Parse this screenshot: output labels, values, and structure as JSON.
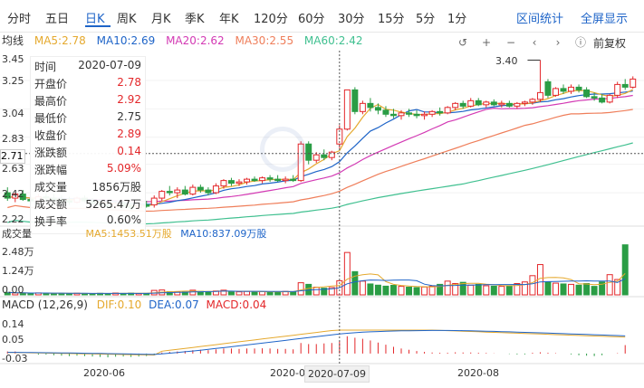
{
  "tabs": [
    "分时",
    "五日",
    "日K",
    "周K",
    "月K",
    "季K",
    "年K",
    "120分",
    "60分",
    "30分",
    "15分",
    "5分",
    "1分"
  ],
  "active_tab": "日K",
  "top_buttons": {
    "interval_stats": "区间统计",
    "fullscreen": "全屏显示"
  },
  "ma": {
    "label": "均线",
    "ma5": "MA5:2.78",
    "ma10": "MA10:2.69",
    "ma20": "MA20:2.62",
    "ma30": "MA30:2.55",
    "ma60": "MA60:2.42",
    "colors": {
      "ma5": "#e5a92e",
      "ma10": "#1e64c8",
      "ma20": "#d33ab4",
      "ma30": "#ef7e5a",
      "ma60": "#40c090"
    }
  },
  "toolbar": {
    "restore": "↺",
    "zoom_in": "+",
    "zoom_out": "−",
    "left": "‹",
    "right": "›",
    "info": "ⓘ",
    "adjust": "前复权"
  },
  "price_axis": [
    "3.45",
    "3.25",
    "3.04",
    "2.83",
    "2.63",
    "2.42",
    "2.22"
  ],
  "current_price_label": "2.71",
  "high_tag": "3.40",
  "tooltip": [
    {
      "label": "时间",
      "value": "2020-07-09",
      "red": false
    },
    {
      "label": "开盘价",
      "value": "2.78",
      "red": true
    },
    {
      "label": "最高价",
      "value": "2.92",
      "red": true
    },
    {
      "label": "最低价",
      "value": "2.75",
      "red": false
    },
    {
      "label": "收盘价",
      "value": "2.89",
      "red": true
    },
    {
      "label": "涨跌额",
      "value": "0.14",
      "red": true
    },
    {
      "label": "涨跌幅",
      "value": "5.09%",
      "red": true
    },
    {
      "label": "成交量",
      "value": "1856万股",
      "red": false
    },
    {
      "label": "成交额",
      "value": "5265.47万",
      "red": false
    },
    {
      "label": "换手率",
      "value": "0.60%",
      "red": false
    }
  ],
  "volume": {
    "label": "成交量",
    "ma5": "MA5:1453.51万股",
    "ma10": "MA10:837.09万股",
    "axis": [
      "2.48万",
      "1.24万",
      "0.00"
    ]
  },
  "macd": {
    "label": "MACD (12,26,9)",
    "dif": "DIF:0.10",
    "dea": "DEA:0.07",
    "macd": "MACD:0.04",
    "axis": [
      "0.14",
      "0.05",
      "-0.03"
    ]
  },
  "x_labels": [
    "2020-06",
    "2020-07",
    "2020-08"
  ],
  "crosshair_date": "2020-07-09",
  "candles": [
    {
      "o": 2.42,
      "h": 2.46,
      "l": 2.36,
      "c": 2.38
    },
    {
      "o": 2.38,
      "h": 2.42,
      "l": 2.35,
      "c": 2.41
    },
    {
      "o": 2.41,
      "h": 2.44,
      "l": 2.36,
      "c": 2.37
    },
    {
      "o": 2.37,
      "h": 2.4,
      "l": 2.33,
      "c": 2.36
    },
    {
      "o": 2.36,
      "h": 2.41,
      "l": 2.34,
      "c": 2.39
    },
    {
      "o": 2.39,
      "h": 2.42,
      "l": 2.36,
      "c": 2.38
    },
    {
      "o": 2.38,
      "h": 2.41,
      "l": 2.35,
      "c": 2.37
    },
    {
      "o": 2.37,
      "h": 2.4,
      "l": 2.34,
      "c": 2.36
    },
    {
      "o": 2.36,
      "h": 2.39,
      "l": 2.33,
      "c": 2.35
    },
    {
      "o": 2.35,
      "h": 2.39,
      "l": 2.34,
      "c": 2.38
    },
    {
      "o": 2.38,
      "h": 2.4,
      "l": 2.35,
      "c": 2.36
    },
    {
      "o": 2.36,
      "h": 2.38,
      "l": 2.33,
      "c": 2.34
    },
    {
      "o": 2.34,
      "h": 2.37,
      "l": 2.31,
      "c": 2.33
    },
    {
      "o": 2.33,
      "h": 2.36,
      "l": 2.3,
      "c": 2.32
    },
    {
      "o": 2.32,
      "h": 2.35,
      "l": 2.3,
      "c": 2.34
    },
    {
      "o": 2.34,
      "h": 2.36,
      "l": 2.31,
      "c": 2.32
    },
    {
      "o": 2.32,
      "h": 2.34,
      "l": 2.29,
      "c": 2.31
    },
    {
      "o": 2.31,
      "h": 2.34,
      "l": 2.29,
      "c": 2.33
    },
    {
      "o": 2.33,
      "h": 2.36,
      "l": 2.31,
      "c": 2.32
    },
    {
      "o": 2.33,
      "h": 2.4,
      "l": 2.31,
      "c": 2.38
    },
    {
      "o": 2.38,
      "h": 2.44,
      "l": 2.36,
      "c": 2.43
    },
    {
      "o": 2.43,
      "h": 2.47,
      "l": 2.4,
      "c": 2.42
    },
    {
      "o": 2.42,
      "h": 2.46,
      "l": 2.38,
      "c": 2.44
    },
    {
      "o": 2.44,
      "h": 2.47,
      "l": 2.4,
      "c": 2.41
    },
    {
      "o": 2.41,
      "h": 2.48,
      "l": 2.4,
      "c": 2.46
    },
    {
      "o": 2.46,
      "h": 2.48,
      "l": 2.42,
      "c": 2.44
    },
    {
      "o": 2.44,
      "h": 2.46,
      "l": 2.4,
      "c": 2.42
    },
    {
      "o": 2.42,
      "h": 2.49,
      "l": 2.41,
      "c": 2.47
    },
    {
      "o": 2.47,
      "h": 2.52,
      "l": 2.45,
      "c": 2.51
    },
    {
      "o": 2.51,
      "h": 2.53,
      "l": 2.47,
      "c": 2.49
    },
    {
      "o": 2.49,
      "h": 2.52,
      "l": 2.47,
      "c": 2.5
    },
    {
      "o": 2.5,
      "h": 2.53,
      "l": 2.48,
      "c": 2.52
    },
    {
      "o": 2.52,
      "h": 2.54,
      "l": 2.5,
      "c": 2.51
    },
    {
      "o": 2.51,
      "h": 2.54,
      "l": 2.49,
      "c": 2.53
    },
    {
      "o": 2.53,
      "h": 2.55,
      "l": 2.5,
      "c": 2.52
    },
    {
      "o": 2.52,
      "h": 2.55,
      "l": 2.5,
      "c": 2.51
    },
    {
      "o": 2.51,
      "h": 2.54,
      "l": 2.49,
      "c": 2.52
    },
    {
      "o": 2.52,
      "h": 2.55,
      "l": 2.5,
      "c": 2.51
    },
    {
      "o": 2.51,
      "h": 2.8,
      "l": 2.5,
      "c": 2.78
    },
    {
      "o": 2.78,
      "h": 2.8,
      "l": 2.63,
      "c": 2.66
    },
    {
      "o": 2.66,
      "h": 2.72,
      "l": 2.64,
      "c": 2.7
    },
    {
      "o": 2.7,
      "h": 2.74,
      "l": 2.66,
      "c": 2.68
    },
    {
      "o": 2.68,
      "h": 2.73,
      "l": 2.66,
      "c": 2.72
    },
    {
      "o": 2.78,
      "h": 2.92,
      "l": 2.75,
      "c": 2.89
    },
    {
      "o": 2.89,
      "h": 3.18,
      "l": 2.88,
      "c": 3.18
    },
    {
      "o": 3.18,
      "h": 3.2,
      "l": 3.0,
      "c": 3.02
    },
    {
      "o": 3.02,
      "h": 3.1,
      "l": 3.0,
      "c": 3.08
    },
    {
      "o": 3.08,
      "h": 3.12,
      "l": 3.02,
      "c": 3.05
    },
    {
      "o": 3.05,
      "h": 3.08,
      "l": 3.0,
      "c": 3.03
    },
    {
      "o": 3.03,
      "h": 3.06,
      "l": 2.98,
      "c": 3.0
    },
    {
      "o": 3.0,
      "h": 3.04,
      "l": 2.97,
      "c": 2.99
    },
    {
      "o": 2.99,
      "h": 3.03,
      "l": 2.96,
      "c": 3.01
    },
    {
      "o": 3.01,
      "h": 3.04,
      "l": 2.98,
      "c": 3.0
    },
    {
      "o": 3.0,
      "h": 3.03,
      "l": 2.97,
      "c": 2.99
    },
    {
      "o": 2.99,
      "h": 3.02,
      "l": 2.96,
      "c": 3.0
    },
    {
      "o": 3.0,
      "h": 3.03,
      "l": 2.98,
      "c": 3.02
    },
    {
      "o": 3.02,
      "h": 3.05,
      "l": 2.99,
      "c": 3.01
    },
    {
      "o": 3.01,
      "h": 3.06,
      "l": 3.0,
      "c": 3.05
    },
    {
      "o": 3.05,
      "h": 3.09,
      "l": 3.03,
      "c": 3.08
    },
    {
      "o": 3.08,
      "h": 3.1,
      "l": 3.04,
      "c": 3.06
    },
    {
      "o": 3.06,
      "h": 3.12,
      "l": 3.05,
      "c": 3.1
    },
    {
      "o": 3.1,
      "h": 3.12,
      "l": 3.06,
      "c": 3.07
    },
    {
      "o": 3.07,
      "h": 3.1,
      "l": 3.05,
      "c": 3.09
    },
    {
      "o": 3.09,
      "h": 3.11,
      "l": 3.06,
      "c": 3.07
    },
    {
      "o": 3.07,
      "h": 3.1,
      "l": 3.05,
      "c": 3.08
    },
    {
      "o": 3.08,
      "h": 3.1,
      "l": 3.05,
      "c": 3.06
    },
    {
      "o": 3.06,
      "h": 3.09,
      "l": 3.04,
      "c": 3.08
    },
    {
      "o": 3.08,
      "h": 3.1,
      "l": 3.06,
      "c": 3.09
    },
    {
      "o": 3.09,
      "h": 3.12,
      "l": 3.07,
      "c": 3.11
    },
    {
      "o": 3.11,
      "h": 3.4,
      "l": 3.09,
      "c": 3.16
    },
    {
      "o": 3.24,
      "h": 3.26,
      "l": 3.12,
      "c": 3.14
    },
    {
      "o": 3.14,
      "h": 3.2,
      "l": 3.13,
      "c": 3.19
    },
    {
      "o": 3.19,
      "h": 3.22,
      "l": 3.15,
      "c": 3.17
    },
    {
      "o": 3.17,
      "h": 3.22,
      "l": 3.15,
      "c": 3.2
    },
    {
      "o": 3.2,
      "h": 3.22,
      "l": 3.16,
      "c": 3.18
    },
    {
      "o": 3.18,
      "h": 3.2,
      "l": 3.12,
      "c": 3.13
    },
    {
      "o": 3.13,
      "h": 3.16,
      "l": 3.1,
      "c": 3.12
    },
    {
      "o": 3.12,
      "h": 3.15,
      "l": 3.08,
      "c": 3.09
    },
    {
      "o": 3.09,
      "h": 3.15,
      "l": 3.08,
      "c": 3.14
    },
    {
      "o": 3.14,
      "h": 3.24,
      "l": 3.12,
      "c": 3.22
    },
    {
      "o": 3.22,
      "h": 3.26,
      "l": 3.18,
      "c": 3.2
    },
    {
      "o": 3.2,
      "h": 3.28,
      "l": 3.19,
      "c": 3.26
    }
  ],
  "volumes": [
    120,
    90,
    80,
    70,
    95,
    85,
    60,
    70,
    65,
    80,
    70,
    60,
    75,
    60,
    90,
    70,
    85,
    65,
    70,
    220,
    240,
    160,
    150,
    140,
    230,
    170,
    150,
    190,
    230,
    160,
    150,
    170,
    140,
    160,
    150,
    140,
    170,
    160,
    600,
    520,
    380,
    330,
    360,
    700,
    2100,
    1150,
    680,
    540,
    480,
    430,
    470,
    420,
    380,
    360,
    390,
    430,
    520,
    680,
    560,
    620,
    480,
    520,
    450,
    430,
    420,
    450,
    560,
    640,
    950,
    1500,
    640,
    580,
    540,
    520,
    480,
    560,
    420,
    640,
    1000,
    760,
    2480
  ],
  "macd_bars": [
    0.01,
    0.01,
    0.0,
    0.0,
    -0.005,
    -0.005,
    -0.008,
    -0.01,
    -0.012,
    -0.01,
    -0.012,
    -0.014,
    -0.016,
    -0.018,
    -0.015,
    -0.014,
    -0.016,
    -0.014,
    -0.012,
    -0.005,
    0.005,
    0.008,
    0.01,
    0.012,
    0.016,
    0.018,
    0.016,
    0.02,
    0.024,
    0.024,
    0.022,
    0.024,
    0.024,
    0.025,
    0.024,
    0.022,
    0.022,
    0.02,
    0.05,
    0.045,
    0.045,
    0.048,
    0.05,
    0.058,
    0.082,
    0.075,
    0.07,
    0.062,
    0.052,
    0.042,
    0.032,
    0.024,
    0.018,
    0.012,
    0.008,
    0.005,
    0.004,
    0.004,
    0.006,
    0.005,
    0.005,
    0.004,
    0.003,
    0.001,
    0.0,
    -0.002,
    -0.004,
    -0.004,
    0.004,
    0.006,
    0.004,
    0.002,
    0.0,
    -0.004,
    -0.008,
    -0.01,
    -0.012,
    -0.008,
    0.0,
    0.002,
    0.04
  ]
}
